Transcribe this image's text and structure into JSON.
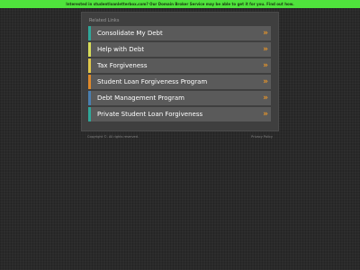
{
  "banner": {
    "text": "Interested in studentloanletterbox.com? Our Domain Broker Service may be able to get it for you. Find out how.",
    "color": "#4fe33c"
  },
  "related": {
    "title": "Related Links",
    "items": [
      {
        "label": "Consolidate My Debt",
        "accent": "#2fa89a",
        "arrow": "»"
      },
      {
        "label": "Help with Debt",
        "accent": "#d8dd5a",
        "arrow": "»"
      },
      {
        "label": "Tax Forgiveness",
        "accent": "#e0c84a",
        "arrow": "»"
      },
      {
        "label": "Student Loan Forgiveness Program",
        "accent": "#e08a2a",
        "arrow": "»"
      },
      {
        "label": "Debt Management Program",
        "accent": "#4a7fb0",
        "arrow": "»"
      },
      {
        "label": "Private Student Loan Forgiveness",
        "accent": "#2fa89a",
        "arrow": "»"
      }
    ]
  },
  "footer": {
    "copyright": "Copyright ©. All rights reserved.",
    "privacy": "Privacy Policy"
  }
}
